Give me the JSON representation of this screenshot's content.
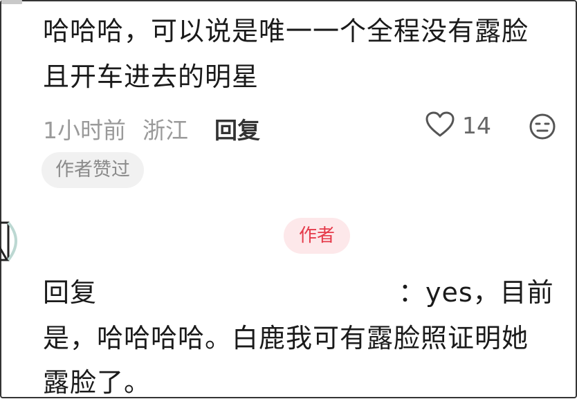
{
  "comment": {
    "line1": "哈哈哈，可以说是唯一一个全程没有露脸",
    "line2": "且开车进去的明星"
  },
  "meta": {
    "time": "1小时前",
    "location": "浙江",
    "reply_label": "回复",
    "like_count": "14"
  },
  "badge": {
    "label": "作者赞过"
  },
  "author_tag": {
    "label": "作者"
  },
  "reply_comment": {
    "prefix": "回复",
    "line1_tail": "：yes，目前",
    "line2": "是，哈哈哈哈。白鹿我可有露脸照证明她",
    "line3": "露脸了。"
  },
  "icons": {
    "like": "heart-outline-icon",
    "reaction": "neutral-face-icon"
  },
  "colors": {
    "author_tag_text": "#e53a4a",
    "author_tag_bg": "#fde8ea",
    "meta_text": "#9a9a9a"
  }
}
